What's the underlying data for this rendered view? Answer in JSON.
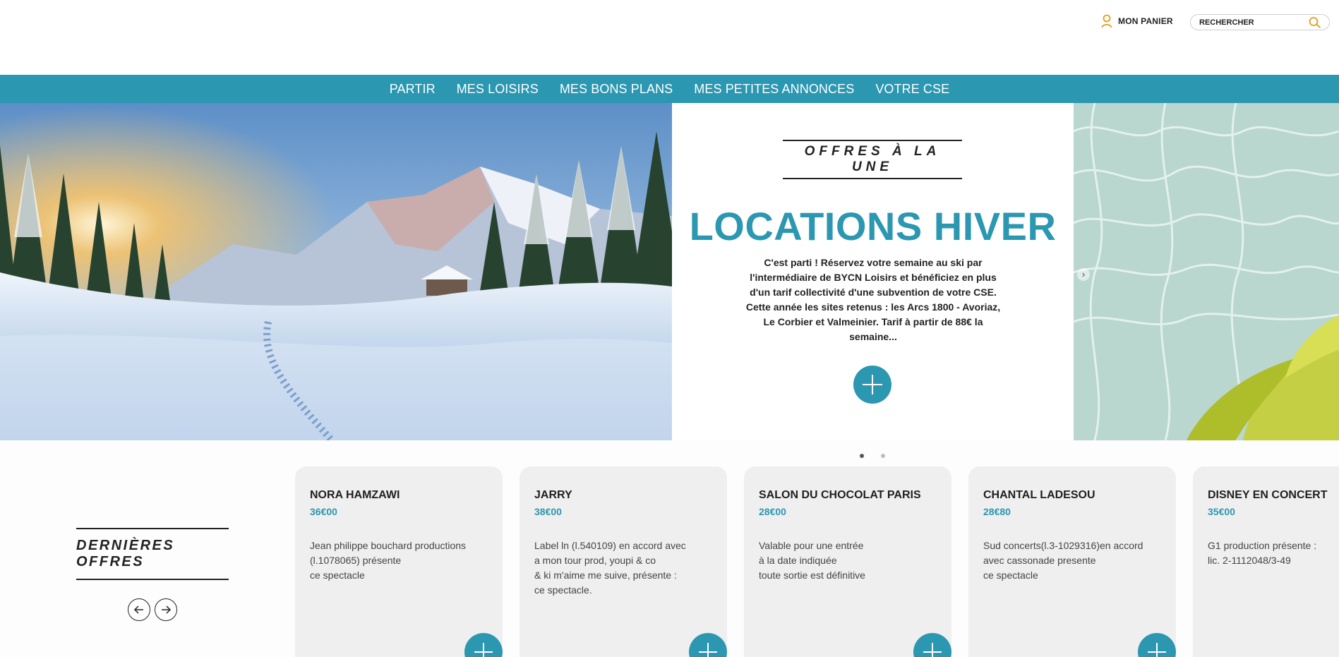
{
  "header": {
    "cart_label": "MON PANIER",
    "cart_icon": "user-icon",
    "search_placeholder": "RECHERCHER",
    "search_icon": "search-icon"
  },
  "nav": {
    "items": [
      {
        "label": "PARTIR"
      },
      {
        "label": "MES LOISIRS"
      },
      {
        "label": "MES BONS PLANS"
      },
      {
        "label": "MES PETITES ANNONCES"
      },
      {
        "label": "VOTRE CSE"
      }
    ]
  },
  "hero": {
    "kicker": "OFFRES À LA UNE",
    "title": "LOCATIONS HIVER",
    "description": "C'est parti ! Réservez votre semaine au ski par l'intermédiaire de BYCN Loisirs et bénéficiez en plus d'un tarif collectivité d'une subvention de votre CSE. Cette année les sites retenus : les Arcs 1800 - Avoriaz, Le Corbier et Valmeinier. Tarif à partir de 88€ la semaine...",
    "next_arrow": "›"
  },
  "latest": {
    "title": "DERNIÈRES OFFRES"
  },
  "offers": [
    {
      "title": "NORA HAMZAWI",
      "price": "36€00",
      "description": "Jean philippe bouchard productions\n(l.1078065) présente\nce spectacle"
    },
    {
      "title": "JARRY",
      "price": "38€00",
      "description": "Label ln (l.540109) en accord avec\na mon tour prod, youpi & co\n& ki m'aime me suive, présente :\nce spectacle."
    },
    {
      "title": "SALON DU CHOCOLAT PARIS",
      "price": "28€00",
      "description": "Valable pour une entrée\nà la date indiquée\ntoute sortie est définitive"
    },
    {
      "title": "CHANTAL LADESOU",
      "price": "28€80",
      "description": "Sud concerts(l.3-1029316)en accord\navec cassonade presente\nce spectacle"
    },
    {
      "title": "DISNEY EN CONCERT",
      "price": "35€00",
      "description": "G1 production présente :\nlic. 2-1112048/3-49"
    }
  ],
  "colors": {
    "accent": "#2b97b1",
    "text": "#1f1f1f",
    "card_bg": "#efefef"
  }
}
